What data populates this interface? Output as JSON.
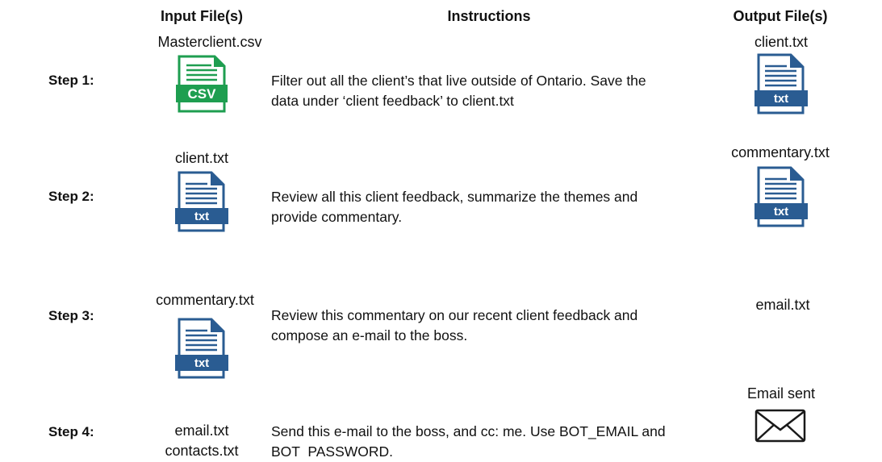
{
  "headers": {
    "input": "Input File(s)",
    "instructions": "Instructions",
    "output": "Output File(s)"
  },
  "steps": [
    {
      "label": "Step 1:",
      "inputs": [
        "Masterclient.csv"
      ],
      "input_icon": "csv-file-icon",
      "instruction_lines": [
        "Filter out all the client’s that live outside of Ontario. Save the",
        "data under ‘client feedback’ to client.txt"
      ],
      "output": "client.txt",
      "output_icon": "txt-file-icon"
    },
    {
      "label": "Step 2:",
      "inputs": [
        "client.txt"
      ],
      "input_icon": "txt-file-icon",
      "instruction_lines": [
        "Review all this client feedback, summarize the themes and",
        "provide commentary."
      ],
      "output": "commentary.txt",
      "output_icon": "txt-file-icon"
    },
    {
      "label": "Step 3:",
      "inputs": [
        "commentary.txt"
      ],
      "input_icon": "txt-file-icon",
      "instruction_lines": [
        "Review this commentary on our recent client feedback and",
        "compose an e-mail to the boss."
      ],
      "output": "email.txt"
    },
    {
      "label": "Step 4:",
      "inputs": [
        "email.txt",
        "contacts.txt"
      ],
      "instruction_lines": [
        "Send this e-mail to the boss, and cc: me. Use BOT_EMAIL and",
        "BOT  PASSWORD."
      ],
      "output": "Email sent",
      "output_icon": "envelope-icon"
    }
  ],
  "icon_text": {
    "csv": "CSV",
    "txt": "txt"
  },
  "colors": {
    "csv_green": "#1e9e50",
    "txt_blue": "#2a5c92"
  }
}
